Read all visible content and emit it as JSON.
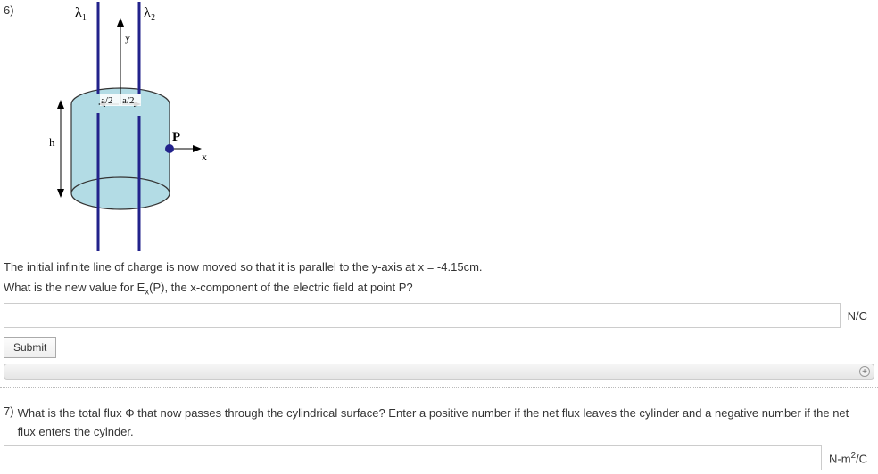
{
  "q6": {
    "number": "6)",
    "diagram_labels": {
      "lambda1": "λ₁",
      "lambda2": "λ₂",
      "y": "y",
      "x": "x",
      "h": "h",
      "P": "P",
      "a2left": "a/2",
      "a2right": "a/2"
    },
    "line1": "The initial infinite line of charge is now moved so that it is parallel to the y-axis at x = -4.15cm.",
    "line2_prefix": "What is the new value for E",
    "line2_sub": "x",
    "line2_suffix": "(P), the x-component of the electric field at point P?",
    "input_value": "",
    "unit": "N/C",
    "submit_label": "Submit"
  },
  "q7": {
    "number": "7)",
    "text": "What is the total flux Φ that now passes through the cylindrical surface? Enter a positive number if the net flux leaves the cylinder and a negative number if the net flux enters the cylnder.",
    "input_value": "",
    "unit_prefix": "N-m",
    "unit_sup": "2",
    "unit_suffix": "/C"
  }
}
